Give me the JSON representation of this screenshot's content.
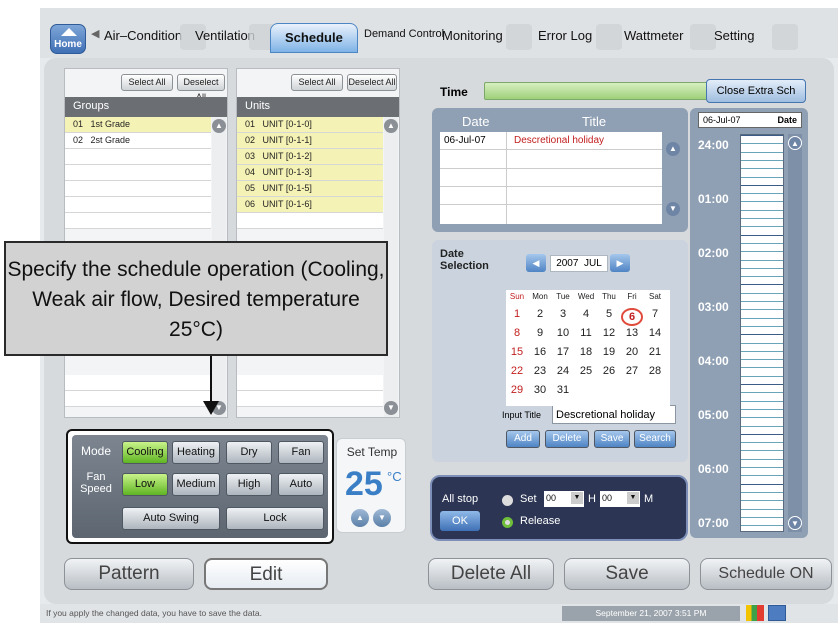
{
  "tabs": {
    "home": "Home",
    "items": [
      "Air–Condition",
      "Ventilation",
      "Schedule",
      "Demand Control",
      "Monitoring",
      "Error Log",
      "Wattmeter",
      "Setting"
    ]
  },
  "groups": {
    "select_all": "Select All",
    "deselect_all": "Deselect All",
    "header": "Groups",
    "rows": [
      {
        "num": "01",
        "name": "1st Grade"
      },
      {
        "num": "02",
        "name": "2st Grade"
      }
    ]
  },
  "units": {
    "select_all": "Select All",
    "deselect_all": "Deselect All",
    "header": "Units",
    "rows": [
      {
        "num": "01",
        "name": "UNIT [0-1-0]"
      },
      {
        "num": "02",
        "name": "UNIT [0-1-1]"
      },
      {
        "num": "03",
        "name": "UNIT [0-1-2]"
      },
      {
        "num": "04",
        "name": "UNIT [0-1-3]"
      },
      {
        "num": "05",
        "name": "UNIT [0-1-5]"
      },
      {
        "num": "06",
        "name": "UNIT [0-1-6]"
      }
    ]
  },
  "callout": {
    "text": "Specify the schedule operation (Cooling, Weak air flow, Desired temperature 25°C)"
  },
  "mode_panel": {
    "mode_label": "Mode",
    "fan_label": "Fan Speed",
    "modes": [
      "Cooling",
      "Heating",
      "Dry",
      "Fan"
    ],
    "selected_mode": "Cooling",
    "fan_speeds": [
      "Low",
      "Medium",
      "High",
      "Auto"
    ],
    "selected_fan": "Low",
    "auto_swing": "Auto Swing",
    "lock": "Lock",
    "set_temp_label": "Set Temp",
    "set_temp_value": "25",
    "set_temp_unit": "°C"
  },
  "time_section": {
    "label": "Time",
    "close_extra": "Close Extra Sch"
  },
  "holiday_table": {
    "headers": [
      "Date",
      "Title"
    ],
    "rows": [
      {
        "date": "06-Jul-07",
        "title": "Descretional holiday"
      }
    ]
  },
  "date_selection": {
    "label": "Date Selection",
    "year": "2007",
    "month": "JUL",
    "weekdays": [
      "Sun",
      "Mon",
      "Tue",
      "Wed",
      "Thu",
      "Fri",
      "Sat"
    ],
    "days": [
      [
        "1",
        "2",
        "3",
        "4",
        "5",
        "6",
        "7"
      ],
      [
        "8",
        "9",
        "10",
        "11",
        "12",
        "13",
        "14"
      ],
      [
        "15",
        "16",
        "17",
        "18",
        "19",
        "20",
        "21"
      ],
      [
        "22",
        "23",
        "24",
        "25",
        "26",
        "27",
        "28"
      ],
      [
        "29",
        "30",
        "31",
        "",
        "",
        "",
        ""
      ]
    ],
    "selected_day": "6",
    "input_title_label": "Input Title",
    "input_title_value": "Descretional holiday",
    "buttons": [
      "Add",
      "Delete",
      "Save",
      "Search"
    ]
  },
  "all_stop": {
    "label": "All stop",
    "ok": "OK",
    "set_label": "Set",
    "hour_value": "00",
    "h": "H",
    "minute_value": "00",
    "m": "M",
    "release_label": "Release"
  },
  "right_timeline": {
    "date_value": "06-Jul-07",
    "date_label": "Date",
    "times": [
      "24:00",
      "01:00",
      "02:00",
      "03:00",
      "04:00",
      "05:00",
      "06:00",
      "07:00"
    ]
  },
  "bottom_buttons": {
    "pattern": "Pattern",
    "edit": "Edit",
    "delete_all": "Delete All",
    "save": "Save",
    "schedule_on": "Schedule ON"
  },
  "footer": {
    "message": "If you apply the changed data,  you have to save the data.",
    "datetime": "September 21, 2007 3:51 PM"
  },
  "colors": {
    "accent_blue": "#4d86c4",
    "selected_green": "#5fb423",
    "temp_blue": "#3a7fc6",
    "holiday_red": "#c21e1e"
  }
}
